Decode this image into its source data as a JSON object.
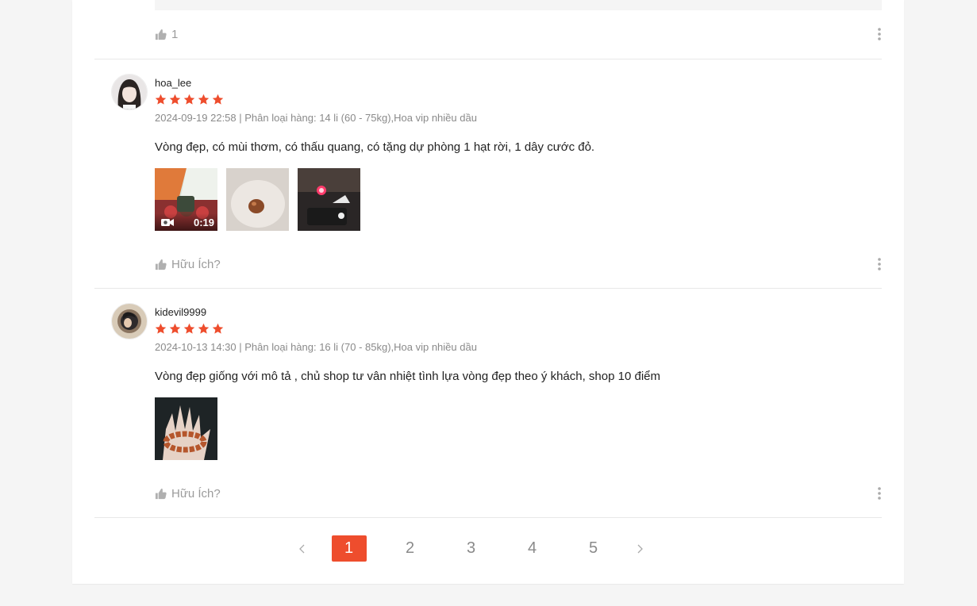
{
  "top_action": {
    "like_count": "1"
  },
  "reviews": [
    {
      "username": "hoa_lee",
      "rating": 5,
      "meta": "2024-09-19 22:58 | Phân loại hàng: 14 li (60 - 75kg),Hoa vip nhiều dầu",
      "content": "Vòng đẹp, có mùi thơm, có thấu quang, có tặng dự phòng 1 hạt rời, 1 dây cước đỏ.",
      "video_duration": "0:19",
      "helpful_label": "Hữu Ích?"
    },
    {
      "username": "kidevil9999",
      "rating": 5,
      "meta": "2024-10-13 14:30 | Phân loại hàng: 16 li (70 - 85kg),Hoa vip nhiều dầu",
      "content": "Vòng đẹp giống với mô tả , chủ shop tư vân nhiệt tình lựa vòng đẹp theo ý khách, shop 10 điểm",
      "helpful_label": "Hữu Ích?"
    }
  ],
  "pagination": {
    "pages": [
      "1",
      "2",
      "3",
      "4",
      "5"
    ],
    "current": "1",
    "prev_icon": "chevron-left-icon",
    "next_icon": "chevron-right-icon"
  },
  "colors": {
    "accent": "#ee4d2d",
    "muted": "#8a8a8a"
  }
}
